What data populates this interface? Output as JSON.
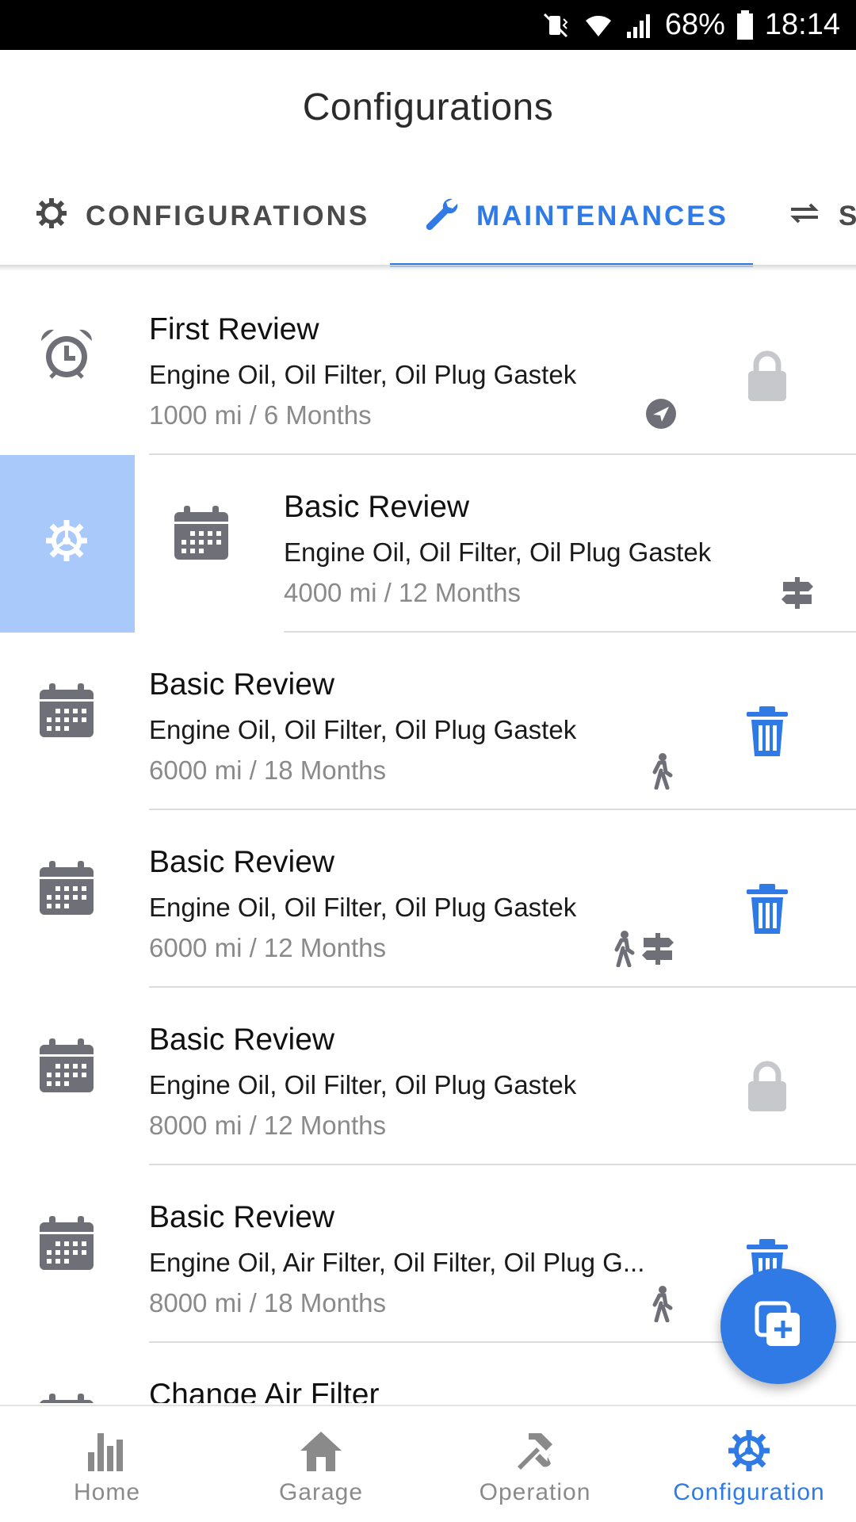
{
  "status_bar": {
    "battery": "68%",
    "time": "18:14",
    "icons": [
      "mute-vibrate-icon",
      "wifi-icon",
      "signal-icon",
      "battery-icon"
    ]
  },
  "header": {
    "title": "Configurations"
  },
  "tabs": [
    {
      "label": "CONFIGURATIONS",
      "icon": "gear-icon",
      "active": false
    },
    {
      "label": "MAINTENANCES",
      "icon": "wrench-icon",
      "active": true
    },
    {
      "label": "S",
      "icon": "swap-icon",
      "active": false
    }
  ],
  "rows": [
    {
      "title": "First Review",
      "subtitle": "Engine Oil, Oil Filter, Oil Plug Gastek",
      "meta": "1000 mi / 6 Months",
      "lead_icon": "alarm-clock-icon",
      "small_icons": [
        "navigation-arrow-icon"
      ],
      "action": "lock-icon"
    },
    {
      "title": "Basic Review",
      "subtitle": "Engine Oil, Oil Filter, Oil Plug Gastek",
      "meta": "4000 mi / 12 Months",
      "lead_icon": "calendar-icon",
      "small_icons": [
        "signpost-icon"
      ],
      "action": "none",
      "swipe_action": "settings-icon"
    },
    {
      "title": "Basic Review",
      "subtitle": "Engine Oil, Oil Filter, Oil Plug Gastek",
      "meta": "6000 mi / 18 Months",
      "lead_icon": "calendar-icon",
      "small_icons": [
        "walking-icon"
      ],
      "action": "trash-icon"
    },
    {
      "title": "Basic Review",
      "subtitle": "Engine Oil, Oil Filter, Oil Plug Gastek",
      "meta": "6000 mi / 12 Months",
      "lead_icon": "calendar-icon",
      "small_icons": [
        "walking-icon",
        "signpost-icon"
      ],
      "action": "trash-icon"
    },
    {
      "title": "Basic Review",
      "subtitle": "Engine Oil, Oil Filter, Oil Plug Gastek",
      "meta": "8000 mi / 12 Months",
      "lead_icon": "calendar-icon",
      "small_icons": [],
      "action": "lock-icon"
    },
    {
      "title": "Basic Review",
      "subtitle": "Engine Oil, Air Filter, Oil Filter, Oil Plug G...",
      "meta": "8000 mi / 18 Months",
      "lead_icon": "calendar-icon",
      "small_icons": [
        "walking-icon"
      ],
      "action": "trash-icon"
    },
    {
      "title": "Change Air Filter",
      "subtitle": "",
      "meta": "",
      "lead_icon": "calendar-icon",
      "small_icons": [],
      "action": "none"
    }
  ],
  "fab": {
    "icon": "add-copy-icon"
  },
  "bottom_nav": [
    {
      "label": "Home",
      "icon": "bar-chart-icon",
      "active": false
    },
    {
      "label": "Garage",
      "icon": "house-icon",
      "active": false
    },
    {
      "label": "Operation",
      "icon": "tools-icon",
      "active": false
    },
    {
      "label": "Configuration",
      "icon": "gear-icon",
      "active": true
    }
  ],
  "colors": {
    "accent": "#2f7ae5",
    "swipe_bg": "#a9c9fb",
    "icon_gray": "#6f7077",
    "lock_gray": "#c7c8cc"
  }
}
